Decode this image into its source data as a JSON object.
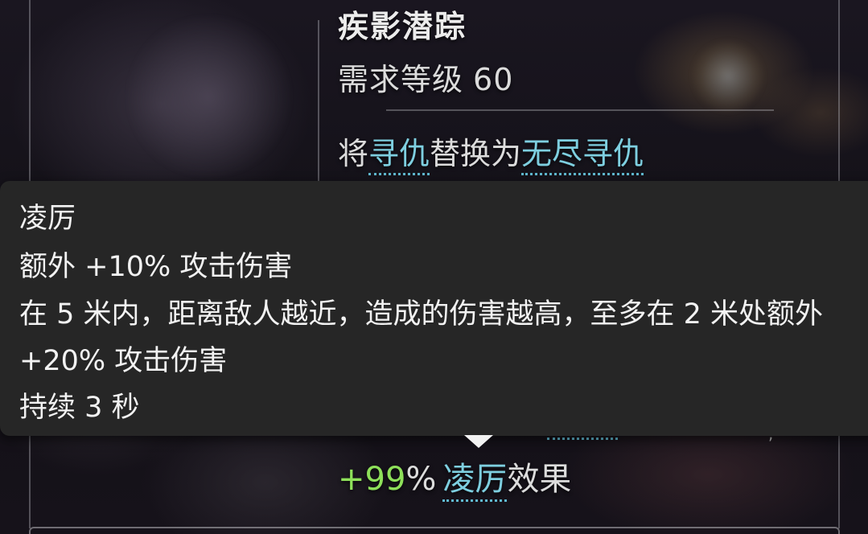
{
  "skill": {
    "title": "疾影潜踪",
    "requirement_label": "需求等级",
    "requirement_level": "60"
  },
  "replace": {
    "prefix": "将",
    "from_skill": "寻仇",
    "middle": "替换为",
    "to_skill": "无尽寻仇"
  },
  "tooltip": {
    "name": "凌厉",
    "line1": "额外 +10% 攻击伤害",
    "line2": "在 5 米内，距离敌人越近，造成的伤害越高，至多在 2 米处额外",
    "line3": "+20% 攻击伤害",
    "line4": "持续 3 秒"
  },
  "bonus": {
    "plus": "+99",
    "percent": "%",
    "keyword": "凌厉",
    "suffix": "效果"
  },
  "colors": {
    "keyword": "#7ecfe0",
    "bonus_green": "#8ee05a",
    "tooltip_bg": "#262626"
  }
}
